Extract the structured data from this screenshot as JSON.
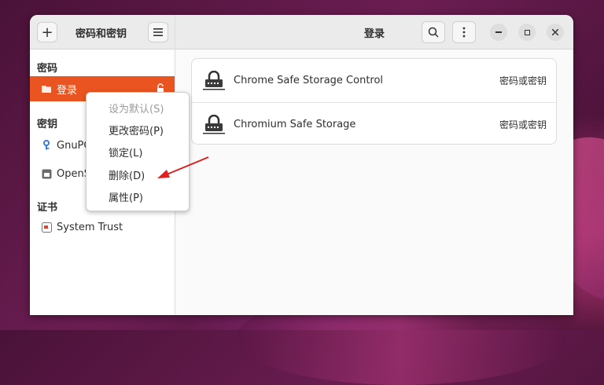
{
  "app": {
    "title": "密码和密钥"
  },
  "header": {
    "title": "登录"
  },
  "sidebar": {
    "sections": [
      {
        "label": "密码"
      },
      {
        "label": "密钥"
      },
      {
        "label": "证书"
      }
    ],
    "items": [
      {
        "label": "登录",
        "icon": "folder-icon"
      },
      {
        "label": "GnuPG",
        "icon": "key-icon"
      },
      {
        "label": "OpenSSH",
        "icon": "ssh-key-icon"
      },
      {
        "label": "System Trust",
        "icon": "certificate-icon"
      }
    ]
  },
  "entries": [
    {
      "name": "Chrome Safe Storage Control",
      "type": "密码或密钥"
    },
    {
      "name": "Chromium Safe Storage",
      "type": "密码或密钥"
    }
  ],
  "context_menu": {
    "items": [
      {
        "label": "设为默认(S)",
        "enabled": false
      },
      {
        "label": "更改密码(P)",
        "enabled": true
      },
      {
        "label": "锁定(L)",
        "enabled": true
      },
      {
        "label": "删除(D)",
        "enabled": true
      },
      {
        "label": "属性(P)",
        "enabled": true
      }
    ]
  },
  "colors": {
    "accent": "#e95420",
    "arrow": "#e02020"
  }
}
